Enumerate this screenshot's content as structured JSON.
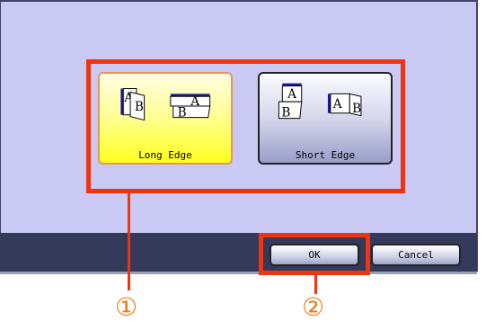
{
  "options": [
    {
      "label": "Long Edge",
      "selected": true
    },
    {
      "label": "Short Edge",
      "selected": false
    }
  ],
  "buttons": {
    "ok": "OK",
    "cancel": "Cancel"
  },
  "callouts": [
    "①",
    "②"
  ],
  "colors": {
    "highlight": "#f1330f",
    "panel": "#c9c9f4",
    "bar": "#353a5a",
    "selected": "#ffff40",
    "callout_number": "#f07a10"
  }
}
